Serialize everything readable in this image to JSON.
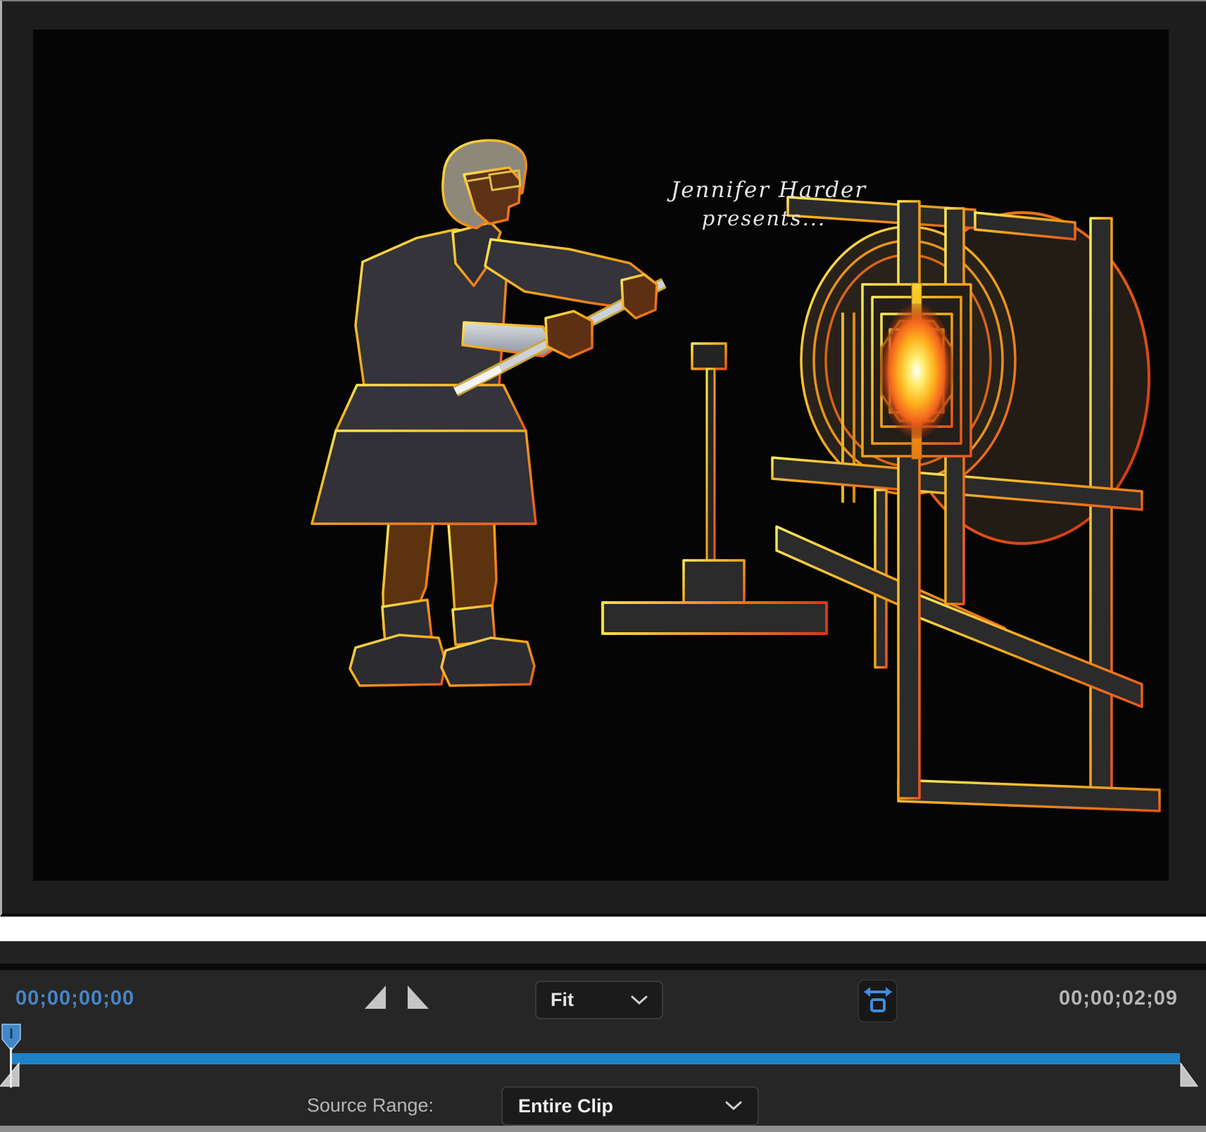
{
  "preview": {
    "credit_line1": "Jennifer Harder",
    "credit_line2": "presents..."
  },
  "transport": {
    "current_timecode": "00;00;00;00",
    "duration_timecode": "00;00;02;09",
    "zoom_select_value": "Fit"
  },
  "source_range": {
    "label": "Source Range:",
    "value": "Entire Clip"
  },
  "icons": {
    "step_back": "step-back-triangle-icon",
    "step_forward": "step-forward-triangle-icon",
    "expand": "resize-frame-icon",
    "chevron": "chevron-down-icon",
    "playhead": "playhead-marker",
    "trim_left": "trim-in-handle",
    "trim_right": "trim-out-handle"
  },
  "colors": {
    "timecode_blue": "#4585c7",
    "duration_gray": "#b5b5b5",
    "bar_blue": "#2082c6",
    "playhead_blue": "#4287c8",
    "icon_blue": "#3e8ede",
    "panel_bg": "#262626",
    "glow_orange": "#ff9a1a",
    "outline_yellow": "#f5cd3a",
    "outline_red": "#e8541e"
  }
}
